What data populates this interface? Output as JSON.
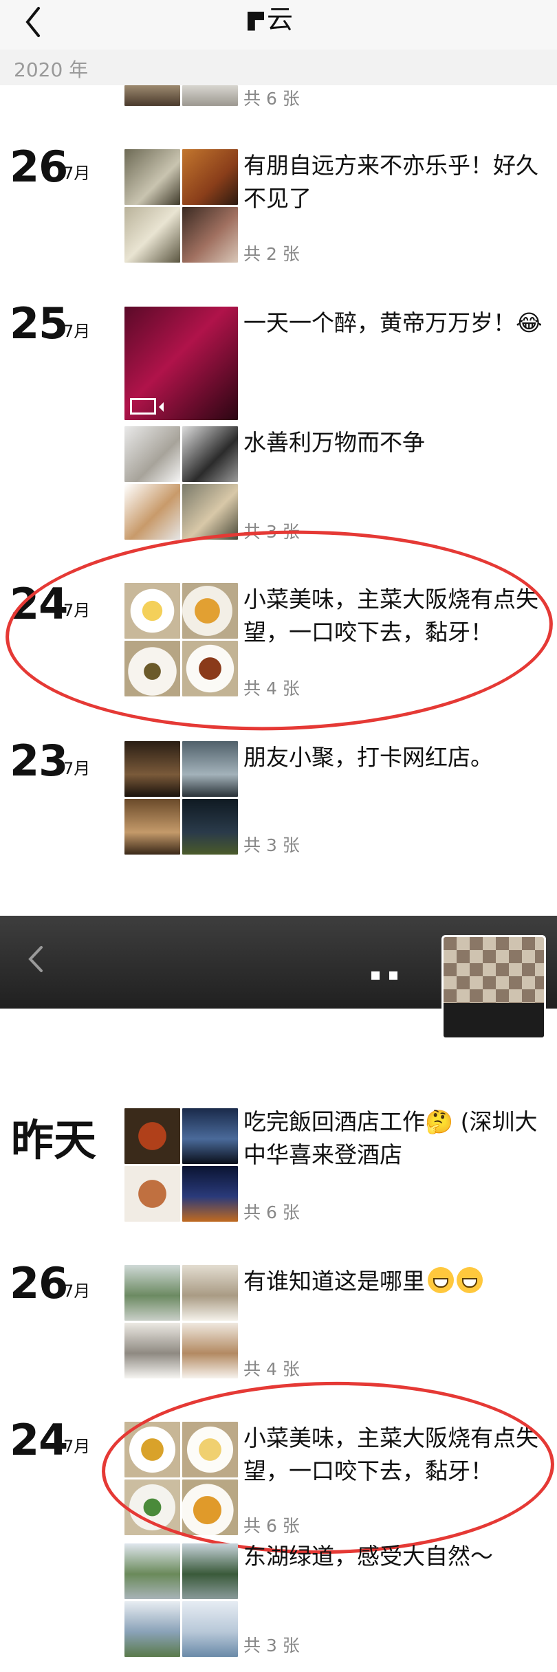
{
  "header": {
    "title": "云",
    "year": "2020 年"
  },
  "colors": {
    "accent_red": "#e53935"
  },
  "icons": {
    "back": "chevron-left-icon",
    "video": "video-icon"
  },
  "section1": {
    "posts": [
      {
        "count": "共 6 张"
      },
      {
        "day": "26",
        "month": "7月",
        "caption": "有朋自远方来不亦乐乎！好久不见了",
        "count": "共 2 张"
      },
      {
        "day": "25",
        "month": "7月",
        "caption": "一天一个醉，黄帝万万岁！😂"
      },
      {
        "caption": "水善利万物而不争",
        "count": "共 3 张"
      },
      {
        "day": "24",
        "month": "7月",
        "caption": "小菜美味，主菜大阪烧有点失望，一口咬下去，黏牙！",
        "count": "共 4 张"
      },
      {
        "day": "23",
        "month": "7月",
        "caption": "朋友小聚，打卡网红店。",
        "count": "共 3 张"
      }
    ]
  },
  "section2": {
    "posts": [
      {
        "day": "昨天",
        "caption": "吃完飯回酒店工作🤔 (深圳大中华喜来登酒店",
        "count": "共 6 张"
      },
      {
        "day": "26",
        "month": "7月",
        "caption": "有谁知道这是哪里",
        "count": "共 4 张"
      },
      {
        "day": "24",
        "month": "7月",
        "caption": "小菜美味，主菜大阪烧有点失望，一口咬下去，黏牙！",
        "count": "共 6 张"
      },
      {
        "caption": "东湖绿道，感受大自然～",
        "count": "共 3 张"
      }
    ]
  }
}
